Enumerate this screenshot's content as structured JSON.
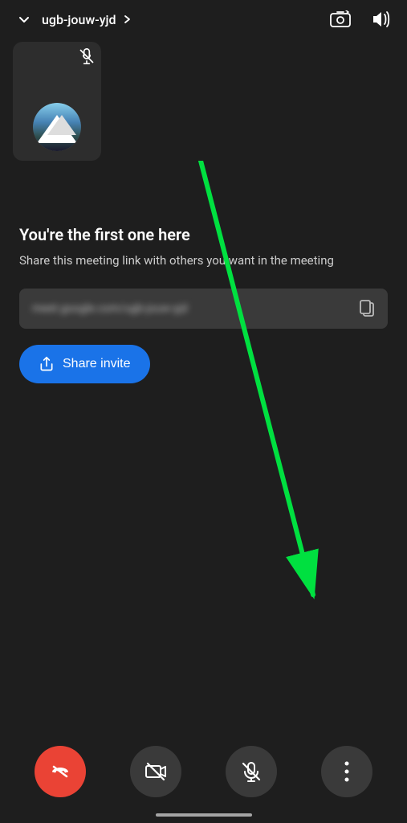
{
  "statusBar": {
    "meetingCode": "ugb-jouw-yjd",
    "arrowLabel": "▶"
  },
  "selfTile": {
    "muteIcon": "mic-off"
  },
  "mainContent": {
    "title": "You're the first one here",
    "description": "Share this meeting link with others you want in the meeting",
    "linkPlaceholder": "meet.google.com/ugb-jouw-yjd",
    "copyIconLabel": "copy",
    "shareButtonLabel": "Share invite"
  },
  "bottomControls": {
    "endCall": "End call",
    "cameraOff": "Camera off",
    "micOff": "Mic off",
    "moreOptions": "More options"
  }
}
